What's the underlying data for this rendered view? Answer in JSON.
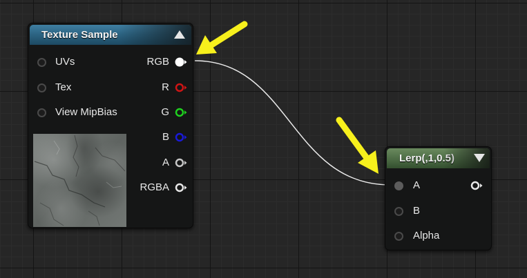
{
  "texture_node": {
    "title": "Texture Sample",
    "inputs": [
      {
        "label": "UVs"
      },
      {
        "label": "Tex"
      },
      {
        "label": "View MipBias"
      }
    ],
    "outputs": [
      {
        "label": "RGB",
        "color": "#ffffff"
      },
      {
        "label": "R",
        "color": "#d01515"
      },
      {
        "label": "G",
        "color": "#1fd21f"
      },
      {
        "label": "B",
        "color": "#1a1ad8"
      },
      {
        "label": "A",
        "color": "#c8c8c8"
      },
      {
        "label": "RGBA",
        "color": "#e8e8e8"
      }
    ],
    "preview_icon": "rock-texture-thumbnail",
    "header_color": "#2d6584"
  },
  "lerp_node": {
    "title": "Lerp(,1,0.5)",
    "inputs": [
      {
        "label": "A"
      },
      {
        "label": "B"
      },
      {
        "label": "Alpha"
      }
    ],
    "output_color": "#e8e8e8",
    "header_color": "#4f6e47"
  },
  "annotation": {
    "arrow_color": "#f7f01c"
  },
  "wire_color": "#ececec"
}
